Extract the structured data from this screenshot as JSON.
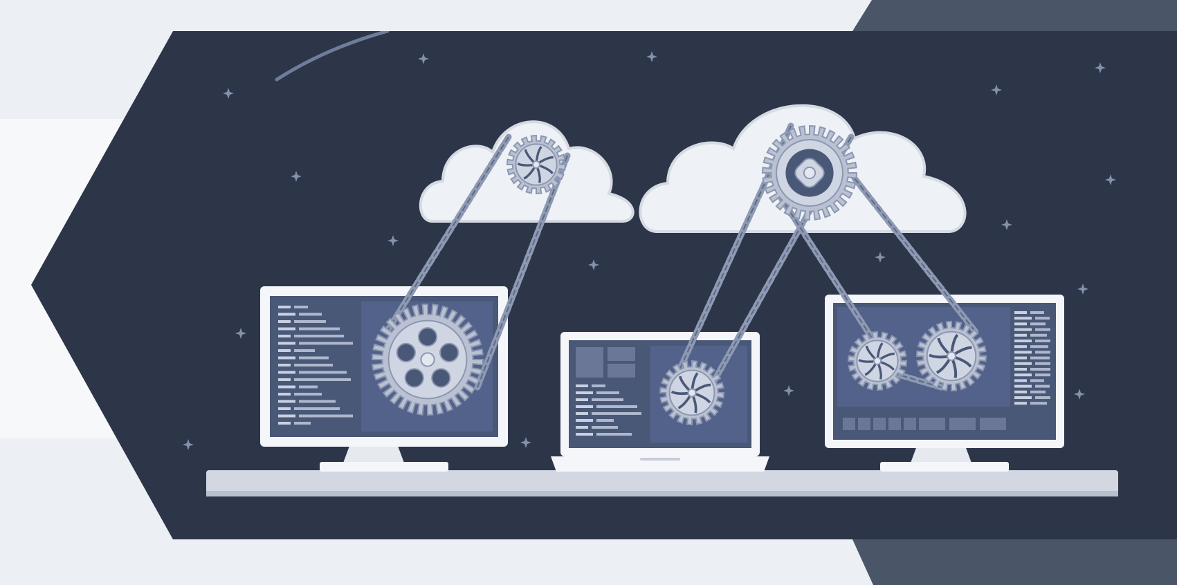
{
  "illustration": {
    "subject": "cloud-computing-gears-illustration",
    "colors": {
      "page_background": "#eceff3",
      "white_band": "#f7f8fa",
      "corner_accent": "#4a5568",
      "panel": "#2d3548",
      "device_frame": "#f4f6f9",
      "screen": "#4a5878",
      "gear_fill": "#b9c1d3",
      "gear_stroke": "#8c97b0",
      "chain": "#8e99b3",
      "cloud": "#eef1f5",
      "cloud_shadow": "#d5dae3",
      "desk": "#d2d7e2",
      "star": "#8391ad"
    },
    "icons": [
      "cloud-icon",
      "gear-icon",
      "chain-icon",
      "monitor-icon",
      "laptop-icon",
      "star-icon"
    ]
  }
}
